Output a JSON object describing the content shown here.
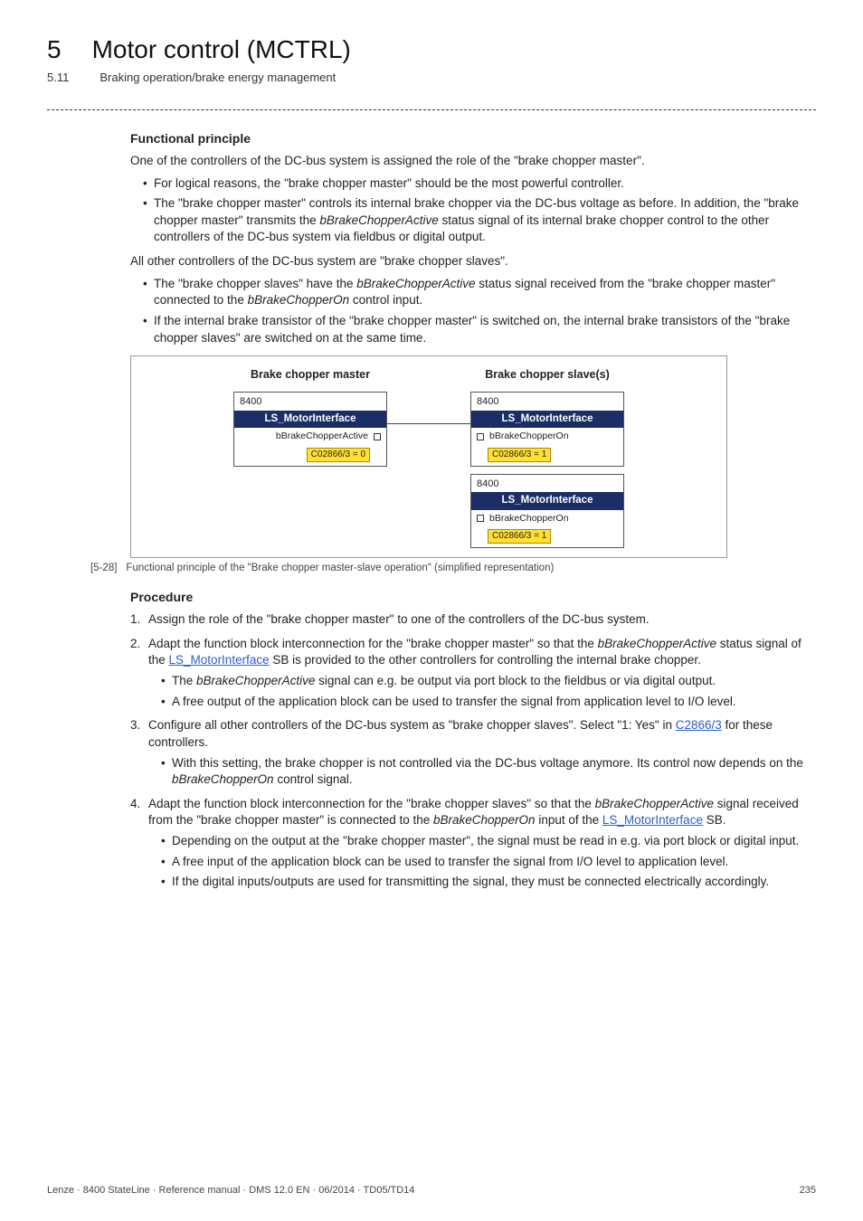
{
  "header": {
    "chapter_num": "5",
    "chapter_title": "Motor control (MCTRL)",
    "section_num": "5.11",
    "section_title": "Braking operation/brake energy management"
  },
  "sec1": {
    "heading": "Functional principle",
    "p1": "One of the controllers of the DC-bus system is assigned the role of the \"brake chopper master\".",
    "b1": "For logical reasons, the \"brake chopper master\" should be the most powerful controller.",
    "b2a": "The \"brake chopper master\" controls its internal brake chopper via the DC-bus voltage as before. In addition, the \"brake chopper master\" transmits the ",
    "b2i": "bBrakeChopperActive",
    "b2b": " status signal of its internal brake chopper control to the other controllers of the DC-bus system via fieldbus or digital output.",
    "p2": "All other controllers of the DC-bus system are \"brake chopper slaves\".",
    "b3a": "The \"brake chopper slaves\" have the ",
    "b3i1": "bBrakeChopperActive",
    "b3b": " status signal received from the \"brake chopper master\" connected to the ",
    "b3i2": "bBrakeChopperOn",
    "b3c": " control input.",
    "b4": "If the internal brake transistor of the \"brake chopper master\" is switched on, the internal brake transistors of the \"brake chopper slaves\" are switched on at the same time."
  },
  "diagram": {
    "master_title": "Brake chopper master",
    "slave_title": "Brake chopper slave(s)",
    "device": "8400",
    "ls": "LS_MotorInterface",
    "sig_master": "bBrakeChopperActive",
    "sig_slave": "bBrakeChopperOn",
    "code_master": "C02866/3 = 0",
    "code_slave": "C02866/3 = 1"
  },
  "caption": {
    "num": "[5-28]",
    "text": "Functional principle of the \"Brake chopper master-slave operation\" (simplified representation)"
  },
  "sec2": {
    "heading": "Procedure",
    "s1": "Assign the role of the \"brake chopper master\" to one of the controllers of the DC-bus system.",
    "s2a": "Adapt the function block interconnection for the \"brake chopper master\" so that the ",
    "s2i": "bBrakeChopperActive",
    "s2b": " status signal of the ",
    "s2link": "LS_MotorInterface",
    "s2c": " SB is provided to the other controllers for controlling the internal brake chopper.",
    "s2_1a": "The ",
    "s2_1i": "bBrakeChopperActive",
    "s2_1b": " signal can e.g. be output via port block to the fieldbus or via digital output.",
    "s2_2": "A free output of the application block can be used to transfer the signal from application level to I/O level.",
    "s3a": "Configure all other controllers of the DC-bus system as \"brake chopper slaves\". Select \"1: Yes\" in ",
    "s3link": "C2866/3",
    "s3b": " for these controllers.",
    "s3_1a": "With this setting, the brake chopper is not controlled via the DC-bus voltage anymore. Its control now depends on the ",
    "s3_1i": "bBrakeChopperOn",
    "s3_1b": " control signal.",
    "s4a": "Adapt the function block interconnection for the \"brake chopper slaves\" so that the ",
    "s4i1": "bBrakeChopperActive",
    "s4b": " signal received from the \"brake chopper master\" is connected to the ",
    "s4i2": "bBrakeChopperOn",
    "s4c": " input of the ",
    "s4link": "LS_MotorInterface",
    "s4d": " SB.",
    "s4_1": "Depending on the output at the \"brake chopper master\", the signal must be read in e.g. via port block or digital input.",
    "s4_2": "A free input of the application block can be used to transfer the signal from I/O level to application level.",
    "s4_3": "If the digital inputs/outputs are used for transmitting the signal, they must be connected electrically accordingly."
  },
  "footer": {
    "left": "Lenze · 8400 StateLine · Reference manual · DMS 12.0 EN · 06/2014 · TD05/TD14",
    "right": "235"
  }
}
